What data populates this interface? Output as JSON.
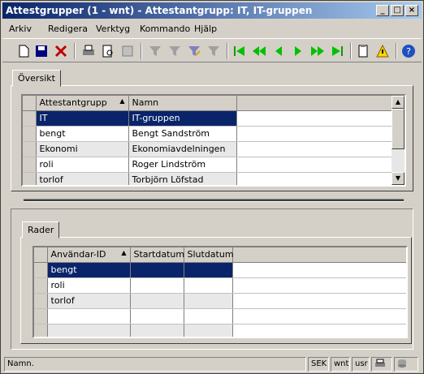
{
  "window": {
    "title": "Attestgrupper (1 - wnt) - Attestantgrupp: IT, IT-gruppen"
  },
  "menu": [
    "Arkiv",
    "Redigera",
    "Verktyg",
    "Kommando",
    "Hjälp"
  ],
  "tabs": {
    "top": "Översikt",
    "bottom": "Rader"
  },
  "top_grid": {
    "columns": [
      "Attestantgrupp",
      "Namn"
    ],
    "rows": [
      [
        "IT",
        "IT-gruppen"
      ],
      [
        "bengt",
        "Bengt Sandström"
      ],
      [
        "Ekonomi",
        "Ekonomiavdelningen"
      ],
      [
        "roli",
        "Roger Lindström"
      ],
      [
        "torlof",
        "Torbjörn Löfstad"
      ]
    ]
  },
  "bottom_grid": {
    "columns": [
      "Användar-ID",
      "Startdatum",
      "Slutdatum"
    ],
    "rows": [
      [
        "bengt",
        "",
        ""
      ],
      [
        "roli",
        "",
        ""
      ],
      [
        "torlof",
        "",
        ""
      ]
    ]
  },
  "status": {
    "text": "Namn.",
    "cells": [
      "SEK",
      "wnt",
      "usr"
    ]
  }
}
